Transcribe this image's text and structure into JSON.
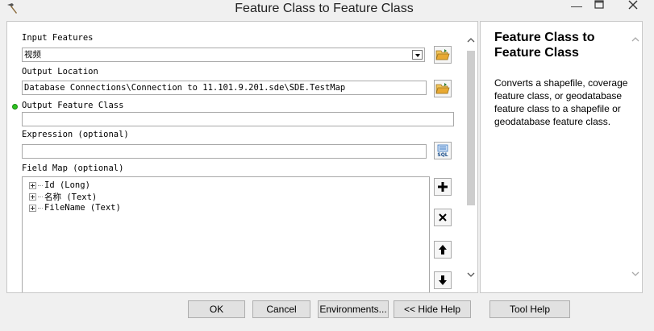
{
  "window": {
    "title": "Feature Class to Feature Class",
    "icons": {
      "app": "hammer-icon",
      "minimize": "minimize-icon",
      "maximize": "maximize-icon",
      "close": "close-icon"
    }
  },
  "form": {
    "input_features": {
      "label": "Input Features",
      "value": "视频"
    },
    "output_location": {
      "label": "Output Location",
      "value": "Database Connections\\Connection to 11.101.9.201.sde\\SDE.TestMap"
    },
    "output_feature_class": {
      "label": "Output Feature Class",
      "value": ""
    },
    "expression": {
      "label": "Expression (optional)",
      "value": ""
    },
    "field_map": {
      "label": "Field Map (optional)",
      "items": [
        "Id (Long)",
        "名称 (Text)",
        "FileName (Text)"
      ]
    }
  },
  "help": {
    "title": "Feature Class to Feature Class",
    "text": "Converts a shapefile, coverage feature class, or geodatabase feature class to a shapefile or geodatabase feature class."
  },
  "buttons": {
    "ok": "OK",
    "cancel": "Cancel",
    "environments": "Environments...",
    "hide_help": "<< Hide Help",
    "tool_help": "Tool Help"
  },
  "colors": {
    "required_dot": "#2cc21f",
    "folder": "#e8b23a",
    "sql": "#3a78c2"
  }
}
